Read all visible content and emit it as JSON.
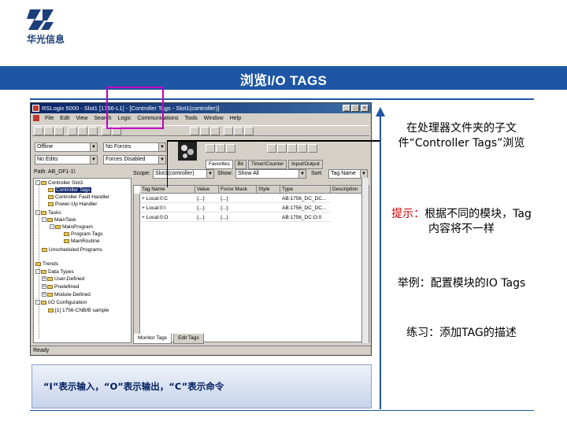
{
  "logo": {
    "text": "华光信息"
  },
  "slide": {
    "title": "浏览I/O TAGS"
  },
  "app": {
    "window_title": "RSLogix 5000 - Slot1 [1756-L1] - [Controller Tags - Slot1(controller)]",
    "menus": [
      "File",
      "Edit",
      "View",
      "Search",
      "Logic",
      "Communications",
      "Tools",
      "Window",
      "Help"
    ],
    "mode_combo": "Offline",
    "forces_combo": "No Forces",
    "edits_combo": "No Edits",
    "forces_disabled_combo": "Forces Disabled",
    "panel_label": "Path: AB_DF1-1\\",
    "toolbar_tabs": [
      "Favorites",
      "Bit",
      "Timer/Counter",
      "Input/Output"
    ],
    "scope_label": "Scope:",
    "scope_value": "Slot1(controller)",
    "show_label": "Show:",
    "show_value": "Show All",
    "sort_label": "Sort:",
    "sort_value": "Tag Name",
    "tree": [
      "Controller Slot1",
      "Controller Tags",
      "Controller Fault Handler",
      "Power-Up Handler",
      "Tasks",
      "MainTask",
      "MainProgram",
      "Program Tags",
      "MainRoutine",
      "Unscheduled Programs",
      "Trends",
      "Data Types",
      "User-Defined",
      "Predefined",
      "Module-Defined",
      "I/O Configuration",
      "[1] 1756-CNB/B sample"
    ],
    "grid_headers": [
      "Tag Name",
      "Value",
      "Force Mask",
      "Style",
      "Type",
      "Description"
    ],
    "rows": [
      {
        "name": "+ Local:0:C",
        "value": "{...}",
        "force": "{...}",
        "style": "",
        "type": "AB:1756_DC_DC..."
      },
      {
        "name": "+ Local:0:I",
        "value": "{...}",
        "force": "{...}",
        "style": "",
        "type": "AB:1756_DC_DC..."
      },
      {
        "name": "+ Local:0:O",
        "value": "{...}",
        "force": "{...}",
        "style": "",
        "type": "AB:1756_DC:O:0"
      }
    ],
    "bottom_tabs": [
      "Monitor Tags",
      "Edit Tags"
    ],
    "status": "Ready"
  },
  "caption": "“I”表示输入，“O”表示输出，“C”表示命令",
  "notes": {
    "n1": "在处理器文件夹的子文件“Controller Tags”浏览",
    "n2_em": "提示：",
    "n2": "根据不同的模块，Tag内容将不一样",
    "n3": "举例：配置模块的IO Tags",
    "n4": "练习：添加TAG的描述"
  },
  "colors": {
    "accent": "#1e56a5",
    "highlight_box": "#c000c0",
    "tip_red": "#d00000"
  }
}
